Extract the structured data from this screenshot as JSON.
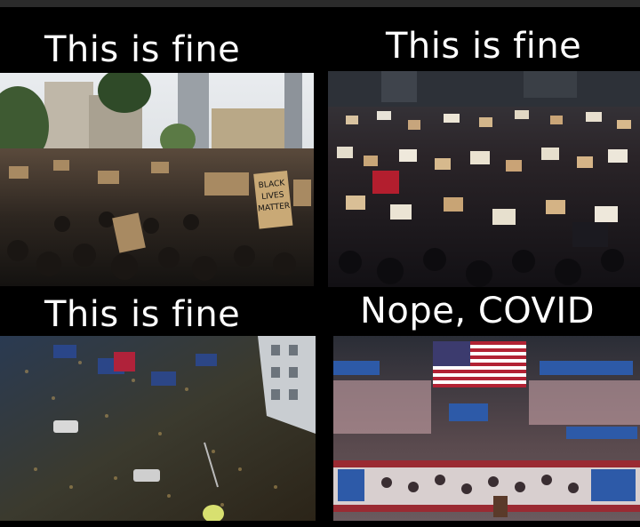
{
  "meme": {
    "panels": [
      {
        "caption": "This is fine",
        "scene": "street-protest-crowd-with-signs"
      },
      {
        "caption": "This is fine",
        "scene": "dense-protest-crowd-with-placards"
      },
      {
        "caption": "This is fine",
        "scene": "aerial-crowd-on-city-street"
      },
      {
        "caption": "Nope, COVID",
        "scene": "indoor-political-rally-arena"
      }
    ],
    "sign_text": [
      "BLACK",
      "LIVES",
      "MATTER"
    ],
    "colors": {
      "background": "#000000",
      "caption": "#ffffff",
      "flag_red": "#b22234",
      "flag_blue": "#3c3b6e"
    }
  }
}
